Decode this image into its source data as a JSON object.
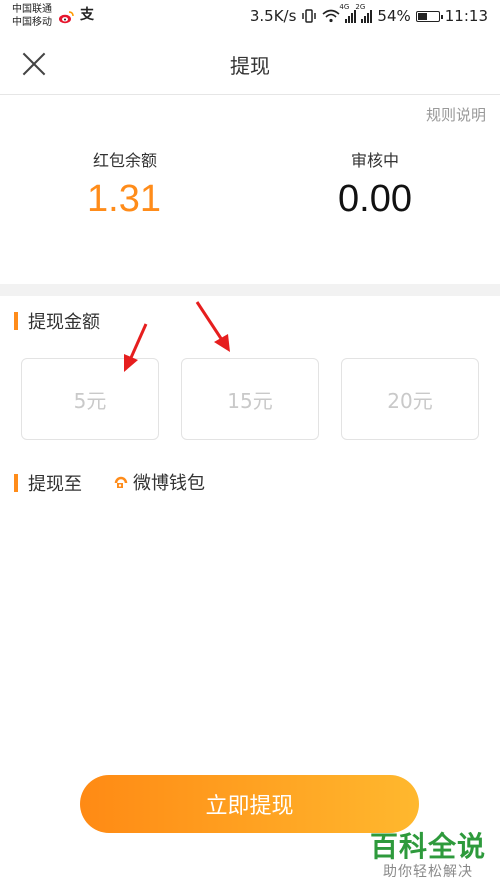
{
  "status_bar": {
    "carrier_1": "中国联通",
    "carrier_2": "中国移动",
    "speed": "3.5K/s",
    "net_1": "4G",
    "net_2": "2G",
    "battery": "54%",
    "battery_level": 0.54,
    "time": "11:13"
  },
  "nav": {
    "title": "提现"
  },
  "rules_link": "规则说明",
  "balance": {
    "red_packet_label": "红包余额",
    "red_packet_value": "1.31",
    "review_label": "审核中",
    "review_value": "0.00"
  },
  "amount_section": {
    "title": "提现金额",
    "options": [
      {
        "label": "5元"
      },
      {
        "label": "15元"
      },
      {
        "label": "20元"
      }
    ]
  },
  "destination": {
    "title": "提现至",
    "wallet": "微博钱包"
  },
  "submit_label": "立即提现",
  "watermark": {
    "title": "百科全说",
    "subtitle": "助你轻松解决"
  },
  "colors": {
    "accent_orange": "#ff8c1a",
    "button_gradient_start": "#ff8a14",
    "button_gradient_end": "#ffb82e",
    "annotation_arrow": "#e61e1e",
    "watermark_green": "#2e9a3c"
  },
  "icons": [
    "weibo-icon",
    "alipay-icon",
    "vibrate-icon",
    "wifi-icon",
    "signal-icon",
    "battery-icon",
    "close-icon",
    "wallet-icon"
  ]
}
